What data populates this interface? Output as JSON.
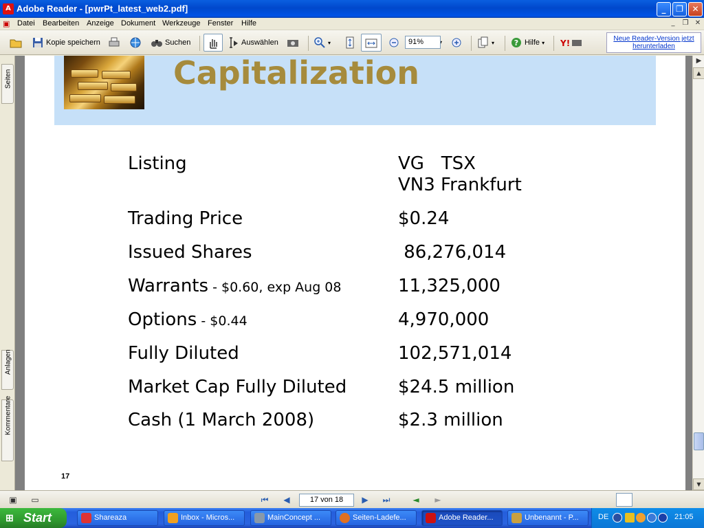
{
  "window": {
    "title": "Adobe Reader - [pwrPt_latest_web2.pdf]",
    "minimize": "_",
    "maximize": "❐",
    "close": "✕"
  },
  "menu": {
    "items": [
      "Datei",
      "Bearbeiten",
      "Anzeige",
      "Dokument",
      "Werkzeuge",
      "Fenster",
      "Hilfe"
    ]
  },
  "toolbar": {
    "save_copy": "Kopie speichern",
    "search": "Suchen",
    "select": "Auswählen",
    "zoom_value": "91%",
    "help": "Hilfe",
    "update_link": "Neue Reader-Version jetzt herunterladen"
  },
  "side_tabs": [
    "Seiten",
    "Anlagen",
    "Kommentare"
  ],
  "slide": {
    "title": "Capitalization",
    "page_number": "17",
    "rows": [
      {
        "label": "Listing",
        "note": "",
        "value": "VG   TSX\nVN3 Frankfurt"
      },
      {
        "label": "Trading Price",
        "note": "",
        "value": "$0.24"
      },
      {
        "label": "Issued Shares",
        "note": "",
        "value": " 86,276,014"
      },
      {
        "label": "Warrants",
        "note": " - $0.60, exp Aug 08",
        "value": "11,325,000"
      },
      {
        "label": "Options",
        "note": " - $0.44",
        "value": "4,970,000"
      },
      {
        "label": "Fully Diluted",
        "note": "",
        "value": "102,571,014"
      },
      {
        "label": "Market Cap Fully Diluted",
        "note": "",
        "value": "$24.5 million"
      },
      {
        "label": "Cash (1 March 2008)",
        "note": "",
        "value": "$2.3 million"
      }
    ]
  },
  "status": {
    "page_field": "17 von 18"
  },
  "taskbar": {
    "start": "Start",
    "tasks": [
      {
        "label": "Shareaza",
        "color": "#d33"
      },
      {
        "label": "Inbox - Micros...",
        "color": "#f0a020"
      },
      {
        "label": "MainConcept ...",
        "color": "#8899aa"
      },
      {
        "label": "Seiten-Ladefe...",
        "color": "#e07020"
      },
      {
        "label": "Adobe Reader...",
        "color": "#cc1111"
      },
      {
        "label": "Unbenannt - P...",
        "color": "#c9a040"
      }
    ],
    "language": "DE",
    "clock": "21:05"
  },
  "colors": {
    "title_gold": "#a68b3c",
    "header_band": "#c6e0f8",
    "xp_blue": "#245edc",
    "start_green": "#2f9a2f"
  }
}
